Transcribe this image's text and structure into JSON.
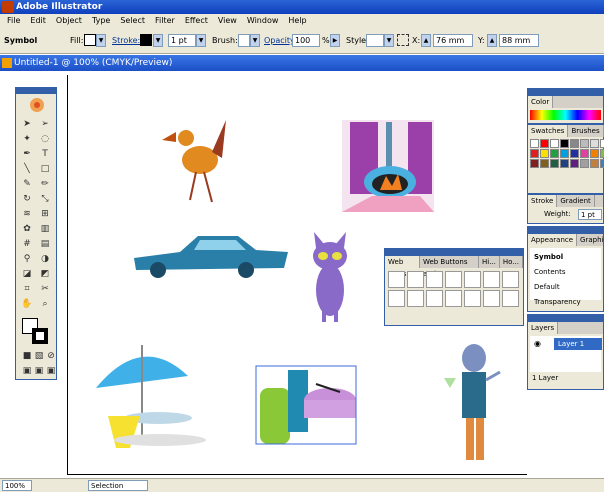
{
  "app": {
    "title": "Adobe Illustrator"
  },
  "menu": [
    "File",
    "Edit",
    "Object",
    "Type",
    "Select",
    "Filter",
    "Effect",
    "View",
    "Window",
    "Help"
  ],
  "control": {
    "selection_label": "Symbol",
    "fill_label": "Fill:",
    "stroke_label": "Stroke:",
    "stroke_weight": "1 pt",
    "brush_label": "Brush:",
    "opacity_label": "Opacity:",
    "opacity_value": "100",
    "opacity_unit": "%",
    "style_label": "Style:",
    "x_value": "76 mm",
    "y_value": "88 mm"
  },
  "document": {
    "tab_title": "Untitled-1 @ 100% (CMYK/Preview)"
  },
  "panels": {
    "color": {
      "tab": "Color"
    },
    "swatches": {
      "tabs": [
        "Swatches",
        "Brushes"
      ]
    },
    "stroke": {
      "tabs": [
        "Stroke",
        "Gradient"
      ],
      "weight_label": "Weight:",
      "weight_value": "1 pt"
    },
    "appearance": {
      "tabs": [
        "Appearance",
        "Graphic"
      ],
      "items": [
        "Symbol",
        "Contents",
        "Default Transparency"
      ]
    },
    "symbols": {
      "tabs": [
        "Web Icons",
        "Web Buttons and...",
        "Hi...",
        "Ho..."
      ]
    },
    "layers": {
      "tab": "Layers",
      "layer_name": "Layer 1",
      "footer": "1 Layer"
    }
  },
  "status": {
    "zoom": "100%",
    "selection": "Selection"
  },
  "colors": {
    "title_bg": "#0f3fbd",
    "chrome": "#ece9d8",
    "panel_border": "#335ea8"
  }
}
